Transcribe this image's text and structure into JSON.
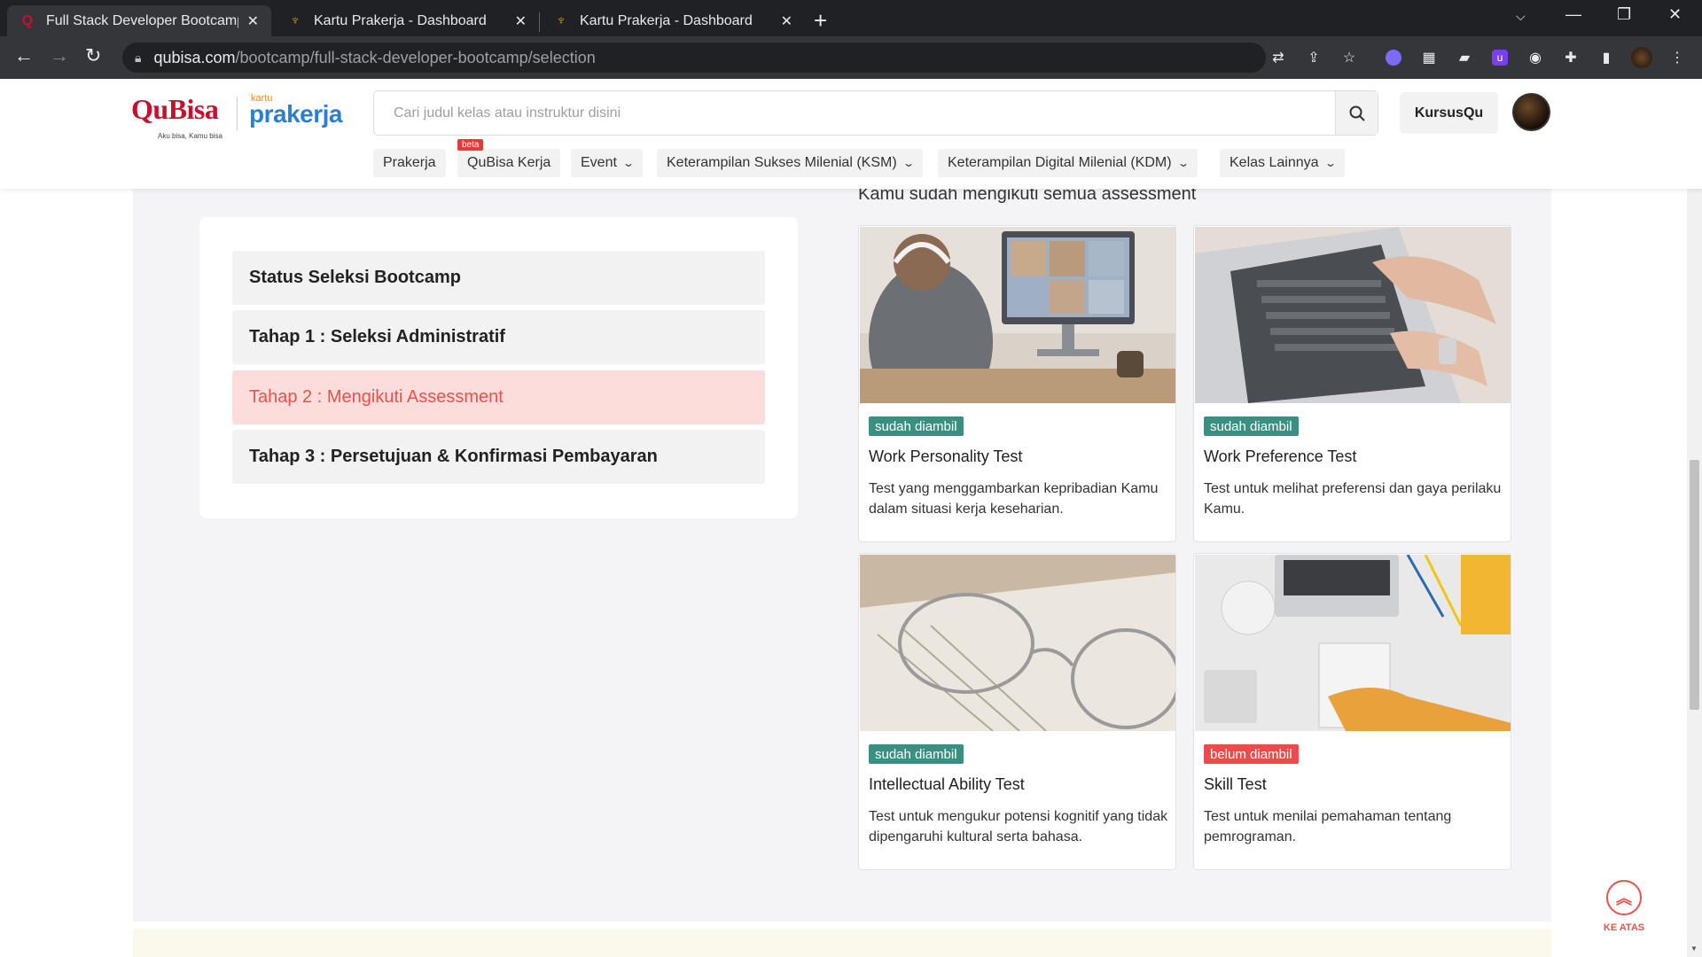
{
  "browser": {
    "tabs": [
      {
        "title": "Full Stack Developer Bootcamp &",
        "active": true
      },
      {
        "title": "Kartu Prakerja - Dashboard",
        "active": false
      },
      {
        "title": "Kartu Prakerja - Dashboard",
        "active": false
      }
    ],
    "url_host": "qubisa.com",
    "url_path": "/bootcamp/full-stack-developer-bootcamp/selection"
  },
  "header": {
    "logo_qubisa": "QuBisa",
    "logo_qubisa_tagline": "Aku bisa, Kamu bisa",
    "logo_prakerja_small": "kartu",
    "logo_prakerja": "prakerja",
    "search_placeholder": "Cari judul kelas atau instruktur disini",
    "kursusqu_label": "KursusQu"
  },
  "nav": {
    "beta_badge": "beta",
    "items": [
      {
        "label": "Prakerja",
        "has_dropdown": false
      },
      {
        "label": "QuBisa Kerja",
        "has_dropdown": false
      },
      {
        "label": "Event",
        "has_dropdown": true
      },
      {
        "label": "Keterampilan Sukses Milenial (KSM)",
        "has_dropdown": true
      },
      {
        "label": "Keterampilan Digital Milenial (KDM)",
        "has_dropdown": true
      },
      {
        "label": "Kelas Lainnya",
        "has_dropdown": true
      }
    ]
  },
  "steps": [
    {
      "label": "Status Seleksi Bootcamp",
      "active": false
    },
    {
      "label": "Tahap 1 : Seleksi Administratif",
      "active": false
    },
    {
      "label": "Tahap 2 : Mengikuti Assessment",
      "active": true
    },
    {
      "label": "Tahap 3 : Persetujuan & Konfirmasi Pembayaran",
      "active": false
    }
  ],
  "assessment": {
    "heading": "Kamu sudah mengikuti semua assessment",
    "cards": [
      {
        "status": "sudah diambil",
        "taken": true,
        "title": "Work Personality Test",
        "desc": "Test yang menggambarkan kepribadian Kamu dalam situasi kerja keseharian."
      },
      {
        "status": "sudah diambil",
        "taken": true,
        "title": "Work Preference Test",
        "desc": "Test untuk melihat preferensi dan gaya perilaku Kamu."
      },
      {
        "status": "sudah diambil",
        "taken": true,
        "title": "Intellectual Ability Test",
        "desc": "Test untuk mengukur potensi kognitif yang tidak dipengaruhi kultural serta bahasa."
      },
      {
        "status": "belum diambil",
        "taken": false,
        "title": "Skill Test",
        "desc": "Test untuk menilai pemahaman tentang pemrograman."
      }
    ]
  },
  "back_to_top": {
    "label": "KE ATAS"
  },
  "colors": {
    "brand_red": "#c8102e",
    "accent": "#e5534b",
    "done_badge": "#3a8f80",
    "notdone_badge": "#ea4b4b"
  }
}
